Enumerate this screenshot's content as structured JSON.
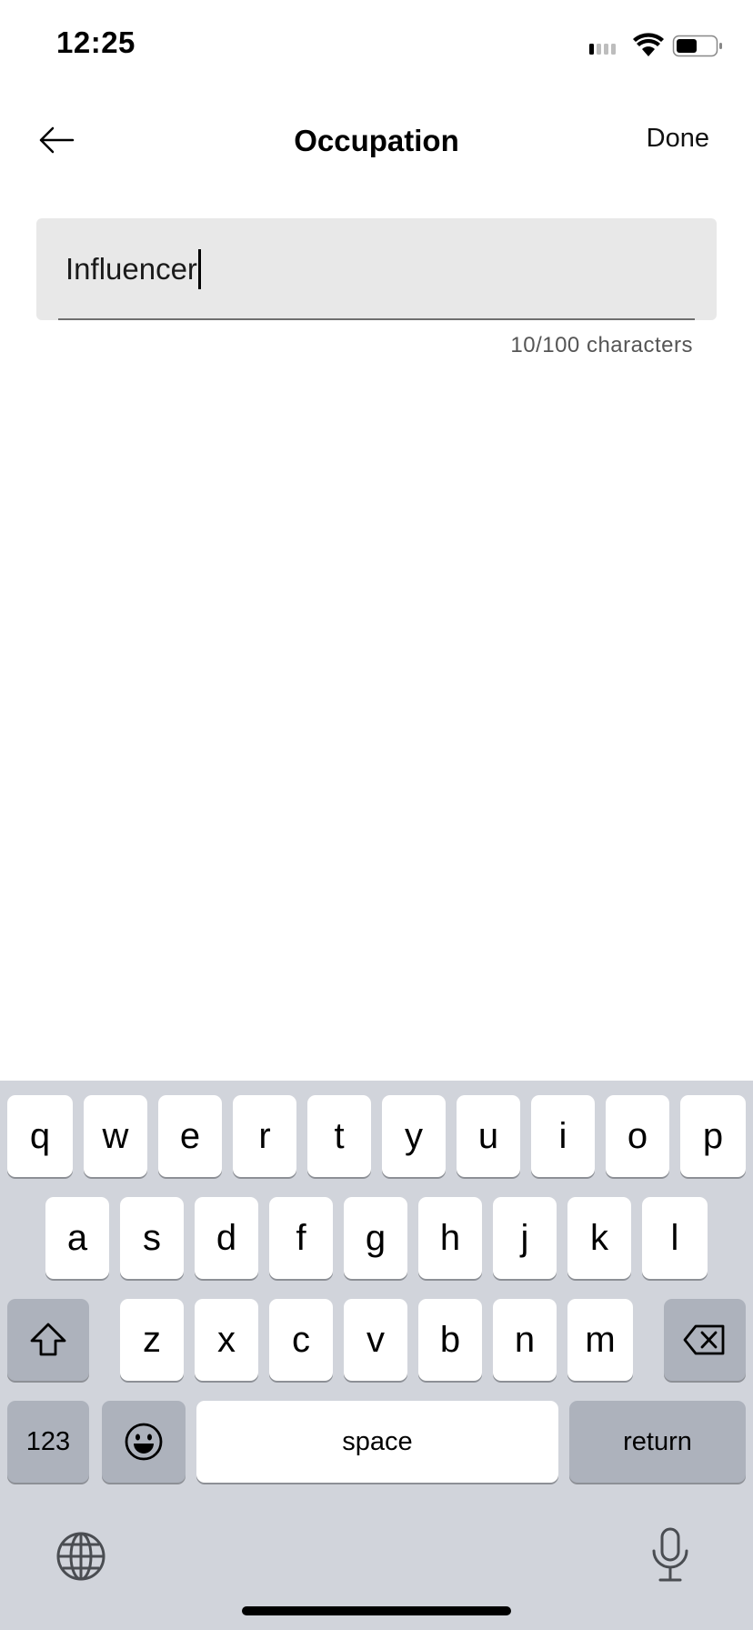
{
  "status_bar": {
    "time": "12:25",
    "icons": [
      "signal-icon",
      "wifi-icon",
      "battery-icon"
    ]
  },
  "nav": {
    "back_icon": "arrow-left-icon",
    "title": "Occupation",
    "done_label": "Done"
  },
  "field": {
    "value": "Influencer",
    "counter": "10/100 characters"
  },
  "keyboard": {
    "row1": [
      "q",
      "w",
      "e",
      "r",
      "t",
      "y",
      "u",
      "i",
      "o",
      "p"
    ],
    "row2": [
      "a",
      "s",
      "d",
      "f",
      "g",
      "h",
      "j",
      "k",
      "l"
    ],
    "row3": [
      "z",
      "x",
      "c",
      "v",
      "b",
      "n",
      "m"
    ],
    "numbers_label": "123",
    "space_label": "space",
    "return_label": "return",
    "shift_icon": "shift-icon",
    "delete_icon": "backspace-icon",
    "emoji_icon": "emoji-icon",
    "globe_icon": "globe-icon",
    "mic_icon": "microphone-icon"
  }
}
